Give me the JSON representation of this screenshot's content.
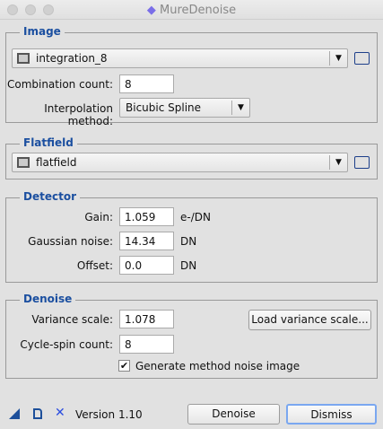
{
  "window": {
    "title": "MureDenoise"
  },
  "image": {
    "title": "Image",
    "view": "integration_8",
    "combination_count_label": "Combination count:",
    "combination_count": "8",
    "interpolation_label": "Interpolation method:",
    "interpolation": "Bicubic Spline"
  },
  "flatfield": {
    "title": "Flatfield",
    "view": "flatfield"
  },
  "detector": {
    "title": "Detector",
    "gain_label": "Gain:",
    "gain": "1.059",
    "gain_unit": "e-/DN",
    "noise_label": "Gaussian noise:",
    "noise": "14.34",
    "noise_unit": "DN",
    "offset_label": "Offset:",
    "offset": "0.0",
    "offset_unit": "DN"
  },
  "denoise": {
    "title": "Denoise",
    "variance_label": "Variance scale:",
    "variance": "1.078",
    "load_variance": "Load variance scale...",
    "cycle_label": "Cycle-spin count:",
    "cycle": "8",
    "generate_label": "Generate method noise image",
    "generate_checked": true
  },
  "footer": {
    "version": "Version 1.10",
    "denoise": "Denoise",
    "dismiss": "Dismiss"
  },
  "colors": {
    "accent": "#1b4fa0",
    "focus": "#7aa7f0"
  }
}
